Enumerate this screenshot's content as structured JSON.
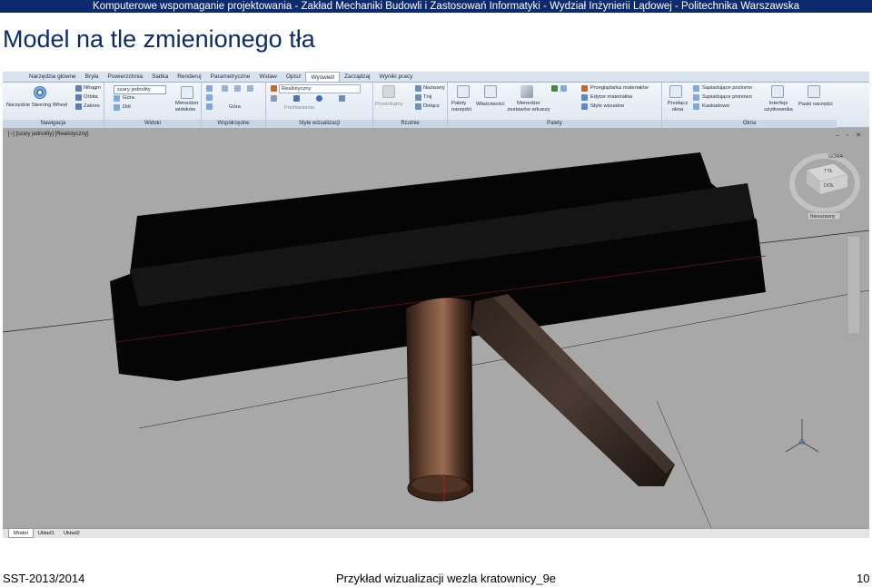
{
  "slide": {
    "header": "Komputerowe wspomaganie projektowania - Zakład Mechaniki Budowli i Zastosowań Informatyki - Wydział Inżynierii Lądowej - Politechnika Warszawska",
    "title": "Model na tle zmienionego tła",
    "footer_left": "SST-2013/2014",
    "footer_center": "Przykład wizualizacji wezla kratownicy_9e",
    "page_number": "10"
  },
  "autocad": {
    "ribbon_tabs": [
      "Narzędzia główne",
      "Bryła",
      "Powierzchnia",
      "Siatka",
      "Renderuj",
      "Parametryczne",
      "Wstaw",
      "Opisz",
      "Wyświetl",
      "Zarządzaj",
      "Wyniki pracy"
    ],
    "active_tab": "Wyświetl",
    "panels": {
      "navigation": {
        "label": "Nawigacja",
        "steering_wheel": "Narzędzie Steering Wheel",
        "pan": "Nfragm",
        "orbit": "Orbita",
        "extents": "Zakres"
      },
      "views": {
        "label": "Widoki",
        "style": "szary jednolity",
        "top": "Góra",
        "bottom": "Dół"
      },
      "coordinates": {
        "label": "Współrzędne",
        "view_manager": "Menedżer widoków",
        "top2": "Góra"
      },
      "visual_styles": {
        "label": "Style wizualizacji",
        "style": "Realistyczny",
        "edges": "Pochłaniania"
      },
      "projections": {
        "label": "Rzutnie",
        "rect": "Prostokątny",
        "names": "Nazwany",
        "clip": "Tnij",
        "join": "Dołącz"
      },
      "palettes": {
        "label": "Palety",
        "tool_palettes": "Palety narzędzi",
        "properties": "Właściwości",
        "sheet_set": "Menedżer zestawów arkuszy",
        "materials_browser": "Przeglądarka materiałów",
        "materials_editor": "Edytor materiałów",
        "visual_styles": "Style wizualne"
      },
      "windows": {
        "label": "Okna",
        "switch": "Przełącz okna",
        "tile_h": "Sąsiadujące poziomo",
        "tile_v": "Sąsiadujące pionowo",
        "cascade": "Kaskadowo",
        "ui": "Interfejs użytkownika",
        "toolbars": "Paski narzędzi"
      }
    },
    "viewport": {
      "label": "[−] [szary jednolity] [Realistyczny]",
      "viewcube_top": "GÓRA",
      "viewcube_bottom": "DÓŁ",
      "viewcube_compass_label": "TYŁ",
      "named_view": "Nienazwany"
    },
    "layout_tabs": [
      "Model",
      "Układ1",
      "Układ2"
    ],
    "active_layout": "Model"
  }
}
